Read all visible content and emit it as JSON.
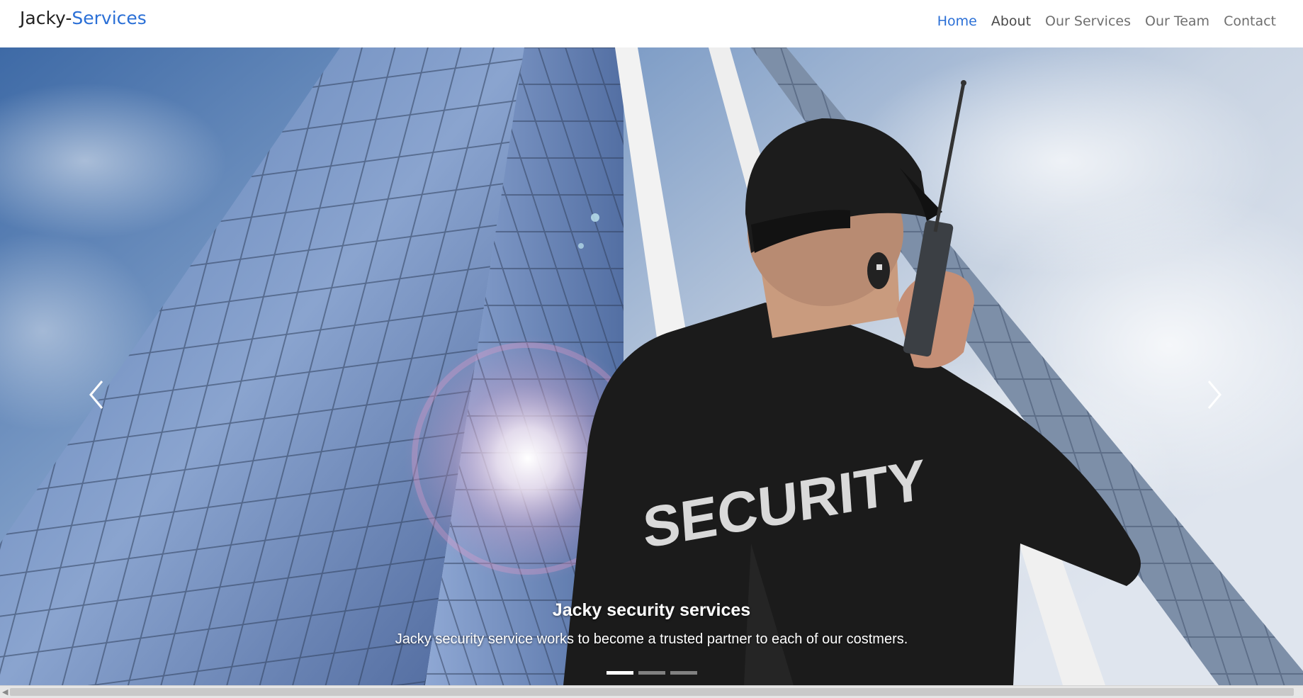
{
  "navbar": {
    "brand_prefix": "Jacky-",
    "brand_accent": "Services",
    "links": [
      {
        "label": "Home",
        "active": true
      },
      {
        "label": "About",
        "active": false
      },
      {
        "label": "Our Services",
        "active": false
      },
      {
        "label": "Our Team",
        "active": false
      },
      {
        "label": "Contact",
        "active": false
      }
    ]
  },
  "carousel": {
    "caption_title": "Jacky security services",
    "caption_text": "Jacky security service works to become a trusted partner to each of our costmers.",
    "jacket_text": "SECURITY",
    "slide_count": 3,
    "active_slide": 1,
    "prev_icon": "chevron-left-icon",
    "next_icon": "chevron-right-icon"
  },
  "colors": {
    "accent": "#2a6fd6",
    "nav_text": "#6f6f6f",
    "sky": "#6f8fb8",
    "jacket": "#1b1b1b"
  }
}
